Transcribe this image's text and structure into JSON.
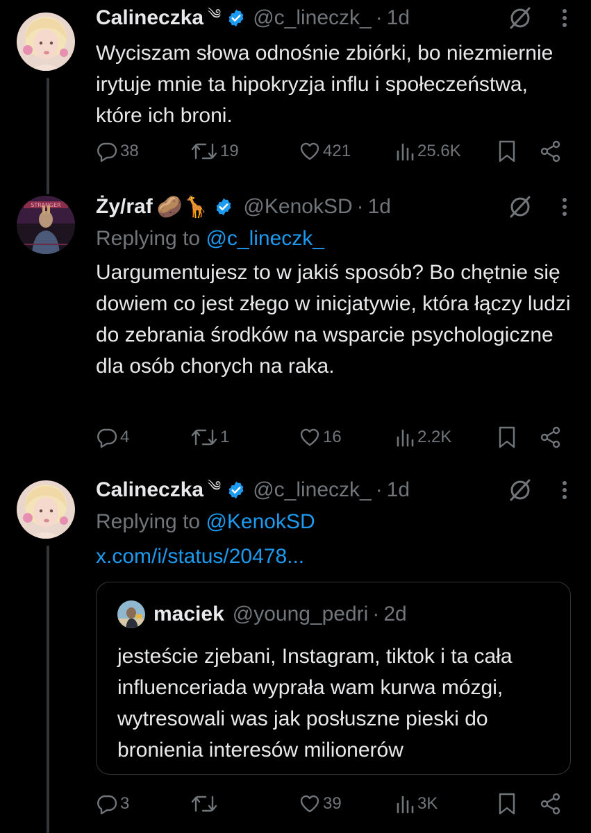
{
  "colors": {
    "background": "#000000",
    "text": "#e7e9ea",
    "muted": "#71767b",
    "link": "#1d9bf0",
    "verified": "#1d9bf0",
    "border": "#333639"
  },
  "tweets": [
    {
      "name": "Calineczka",
      "name_extra": "༄",
      "handle": "@c_lineczk_",
      "time": "1d",
      "text": "Wyciszam słowa odnośnie zbiórki, bo niezmiernie irytuje mnie ta hipokryzja influ i społeczeństwa, które ich broni.",
      "stats": {
        "replies": "38",
        "retweets": "19",
        "likes": "421",
        "views": "25.6K"
      }
    },
    {
      "name": "Ży/raf",
      "name_extra": "🥔🦒",
      "handle": "@KenokSD",
      "time": "1d",
      "reply_prefix": "Replying to",
      "reply_to": "@c_lineczk_",
      "text": "Uargumentujesz to w jakiś sposób? Bo chętnie się dowiem co jest złego w inicjatywie, która łączy ludzi do zebrania środków na wsparcie psychologiczne dla osób chorych na raka.",
      "stats": {
        "replies": "4",
        "retweets": "1",
        "likes": "16",
        "views": "2.2K"
      }
    },
    {
      "name": "Calineczka",
      "name_extra": "༄",
      "handle": "@c_lineczk_",
      "time": "1d",
      "reply_prefix": "Replying to",
      "reply_to": "@KenokSD",
      "link": "x.com/i/status/20478...",
      "quote": {
        "name": "maciek",
        "handle": "@young_pedri",
        "time": "2d",
        "text": "jesteście zjebani, Instagram, tiktok i ta cała influenceriada wyprała wam kurwa mózgi, wytresowali was jak posłuszne pieski do bronienia interesów milionerów"
      },
      "stats": {
        "replies": "3",
        "retweets": "",
        "likes": "39",
        "views": "3K"
      }
    }
  ],
  "icons": {
    "verified": "verified-badge-icon",
    "grok": "grok-icon",
    "more": "more-icon",
    "reply": "reply-icon",
    "retweet": "retweet-icon",
    "like": "like-icon",
    "views": "views-icon",
    "bookmark": "bookmark-icon",
    "share": "share-icon"
  }
}
